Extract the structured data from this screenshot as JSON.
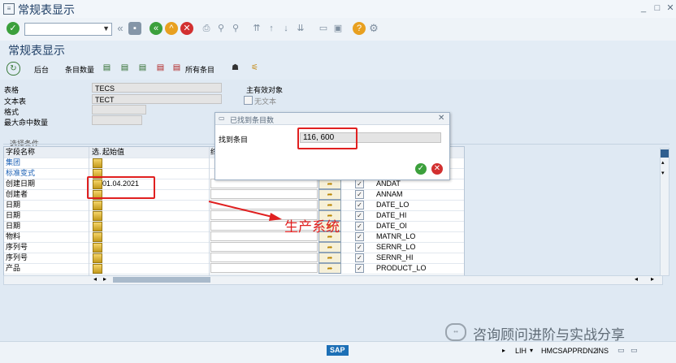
{
  "window": {
    "title": "常规表显示"
  },
  "toolbar": {
    "command_value": ""
  },
  "header": {
    "title": "常规表显示"
  },
  "app_toolbar": {
    "back_label": "后台",
    "count_label": "条目数量",
    "all_entries_label": "所有条目"
  },
  "form": {
    "table_label": "表格",
    "table_value": "TECS",
    "text_table_label": "文本表",
    "text_table_value": "TECT",
    "format_label": "格式",
    "format_value": "",
    "max_hits_label": "最大命中数量",
    "max_hits_value": "",
    "main_objects_label": "主有效对象",
    "no_text_label": "无文本"
  },
  "selection": {
    "section_title": "选择条件",
    "col_field_name": "字段名称",
    "col_select": "选.",
    "col_from_value": "起始值",
    "col_to_value": "终",
    "rows": [
      {
        "name": "集团",
        "link": true,
        "from": "",
        "field": ""
      },
      {
        "name": "标准变式",
        "link": true,
        "from": "",
        "field": ""
      },
      {
        "name": "创建日期",
        "link": false,
        "from": "01.04.2021",
        "field": "ANDAT"
      },
      {
        "name": "创建者",
        "link": false,
        "from": "",
        "field": "ANNAM"
      },
      {
        "name": "日期",
        "link": false,
        "from": "",
        "field": "DATE_LO"
      },
      {
        "name": "日期",
        "link": false,
        "from": "",
        "field": "DATE_HI"
      },
      {
        "name": "日期",
        "link": false,
        "from": "",
        "field": "DATE_OI"
      },
      {
        "name": "物料",
        "link": false,
        "from": "",
        "field": "MATNR_LO"
      },
      {
        "name": "序列号",
        "link": false,
        "from": "",
        "field": "SERNR_LO"
      },
      {
        "name": "序列号",
        "link": false,
        "from": "",
        "field": "SERNR_HI"
      },
      {
        "name": "产品",
        "link": false,
        "from": "",
        "field": "PRODUCT_LO"
      }
    ]
  },
  "dialog": {
    "title": "已找到条目数",
    "found_label": "找到条目",
    "found_value": "116, 600"
  },
  "annotation": {
    "text": "生产系统"
  },
  "watermark": {
    "text": "咨询顾问进阶与实战分享"
  },
  "status_bar": {
    "sap_logo": "SAP",
    "client": "LIH",
    "server": "HMCSAPPRDN2",
    "mode": "INS"
  },
  "colors": {
    "accent": "#1f3f66",
    "annotation_red": "#e02020",
    "ok_green": "#3ca03c",
    "cancel_red": "#d23030"
  }
}
